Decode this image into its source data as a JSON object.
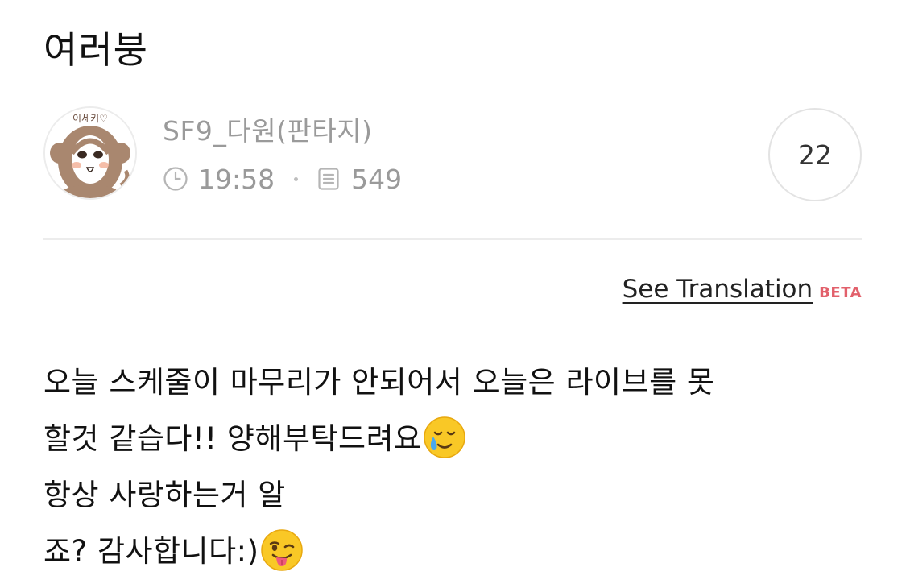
{
  "post": {
    "title": "여러붕",
    "author": "SF9_다원(판타지)",
    "time": "19:58",
    "views": "549",
    "comment_count": "22",
    "translation_link": "See Translation",
    "translation_badge": "BETA",
    "avatar_caption": "이세키♡",
    "content_lines": [
      "오늘 스케줄이 마무리가 안되어서 오늘은 라이브를 못",
      "할것 같습다!! 양해부탁드려요",
      " 항상 사랑하는거 알",
      "죠? 감사합니다:)"
    ]
  },
  "icons": {
    "time": "clock-icon",
    "views": "document-icon",
    "emoji_1": "smiling-face-with-tear-emoji",
    "emoji_2": "winking-face-with-tongue-emoji"
  },
  "colors": {
    "beta": "#e2606b",
    "meta_gray": "#9a9a9a",
    "divider": "#ececec"
  }
}
